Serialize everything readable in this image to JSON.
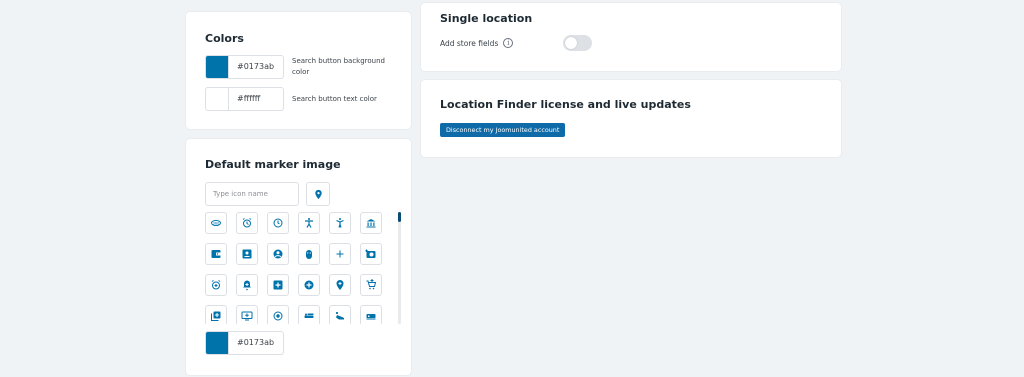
{
  "colors": {
    "title": "Colors",
    "rows": [
      {
        "swatch": "#0173ab",
        "hex": "#0173ab",
        "label": "Search button background color"
      },
      {
        "swatch": "#ffffff",
        "hex": "#ffffff",
        "label": "Search button text color"
      }
    ]
  },
  "marker": {
    "title": "Default marker image",
    "search_placeholder": "Type icon name",
    "icons": [
      "360-rotate-icon",
      "alarm-icon",
      "clock-icon",
      "accessibility-icon",
      "accessibility-new-icon",
      "bank-icon",
      "wallet-icon",
      "contact-card-icon",
      "account-circle-icon",
      "adb-icon",
      "add-icon",
      "add-a-photo-icon",
      "add-alarm-icon",
      "add-alert-icon",
      "add-box-icon",
      "add-circle-icon",
      "add-location-icon",
      "add-shopping-cart-icon",
      "add-to-photos-icon",
      "add-to-queue-icon",
      "adjust-icon",
      "airline-seat-flat-icon",
      "airline-seat-angled-icon",
      "airline-seat-extra-icon"
    ],
    "color_hex": "#0173ab",
    "color_swatch": "#0173ab"
  },
  "single_location": {
    "title": "Single location",
    "field_label": "Add store fields",
    "toggle_on": false
  },
  "license": {
    "title": "Location Finder license and live updates",
    "button_label": "Disconnect my Joomunited account"
  },
  "accent": "#0173ab"
}
